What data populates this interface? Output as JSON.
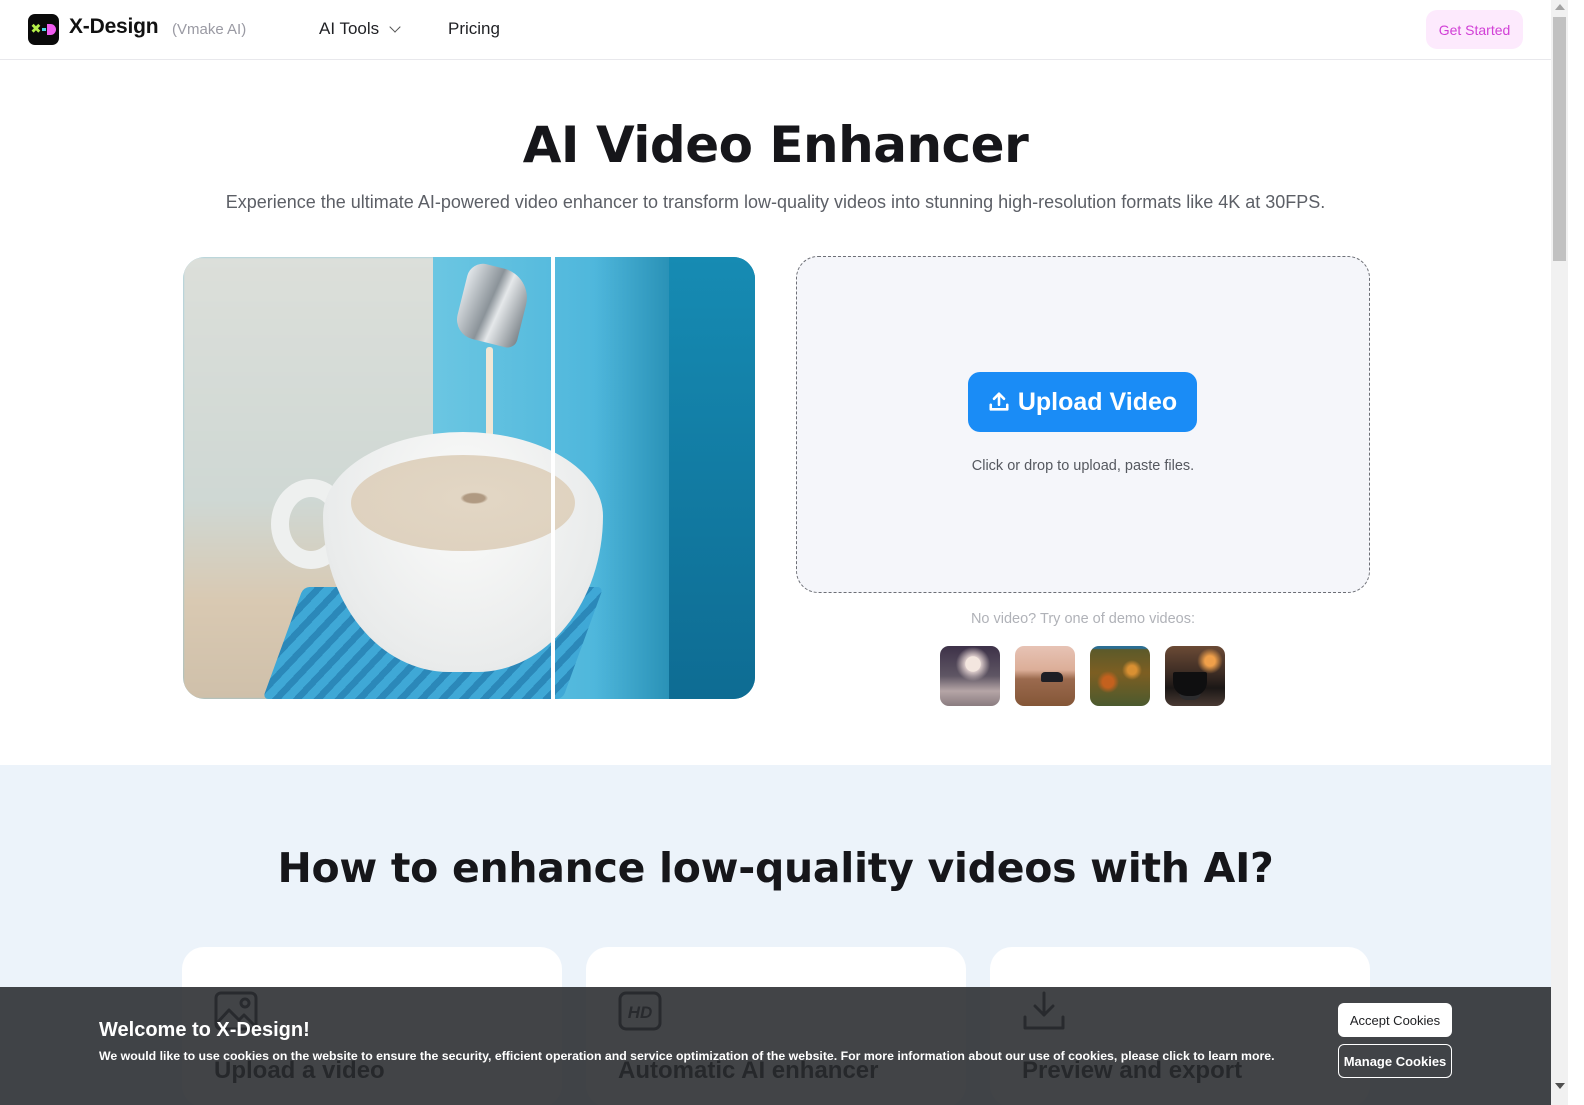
{
  "header": {
    "brand_name": "X-Design",
    "brand_sub": "(Vmake AI)",
    "nav": [
      {
        "label": "AI Tools",
        "has_dropdown": true
      },
      {
        "label": "Pricing",
        "has_dropdown": false
      }
    ],
    "cta_label": "Get Started",
    "cta_color": "#d13fd6",
    "cta_bg": "#fdeafd"
  },
  "hero": {
    "title": "AI Video Enhancer",
    "subtitle": "Experience the ultimate AI-powered video enhancer to transform low-quality videos into stunning high-resolution formats like 4K at 30FPS.",
    "preview_image": "coffee-cup-before-after-comparison",
    "upload_button_label": "Upload Video",
    "upload_button_color": "#1a8cf6",
    "upload_hint": "Click or drop to upload, paste files.",
    "demo_label": "No video? Try one of demo videos:",
    "demo_videos": [
      {
        "subject": "woman-portrait"
      },
      {
        "subject": "car-in-desert"
      },
      {
        "subject": "autumn-forest-aerial"
      },
      {
        "subject": "coffee-cup-cafe"
      }
    ]
  },
  "how_to": {
    "title": "How to enhance low-quality videos with AI?",
    "steps": [
      {
        "icon": "image-icon",
        "label": "Upload a video"
      },
      {
        "icon": "hd-icon",
        "label": "Automatic AI enhancer"
      },
      {
        "icon": "download-icon",
        "label": "Preview and export"
      }
    ]
  },
  "cookie_banner": {
    "title": "Welcome to X-Design!",
    "text": "We would like to use cookies on the website to ensure the security, efficient operation and service optimization of the website. For more information about our use of cookies, please click to learn more.",
    "accept_label": "Accept Cookies",
    "manage_label": "Manage Cookies"
  }
}
